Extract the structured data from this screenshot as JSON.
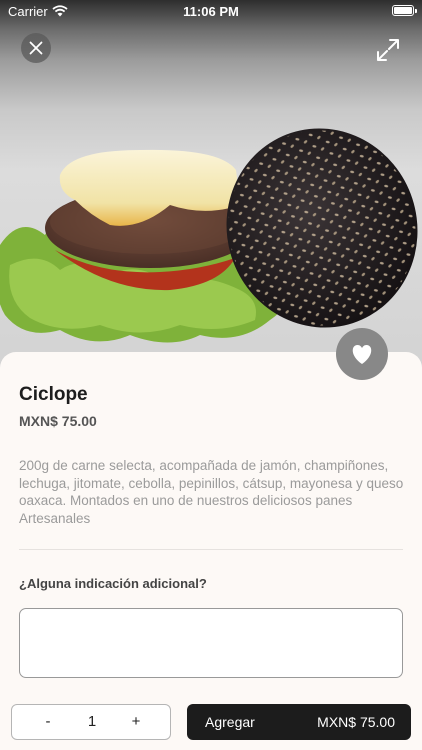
{
  "status_bar": {
    "carrier": "Carrier",
    "time": "11:06 PM"
  },
  "icons": {
    "close": "close-icon",
    "expand": "expand-icon",
    "favorite": "heart-icon",
    "wifi": "wifi-icon",
    "battery": "battery-icon"
  },
  "product": {
    "name": "Ciclope",
    "price": "MXN$ 75.00",
    "description": "200g de carne selecta, acompañada de jamón, champiñones, lechuga, jitomate, cebolla, pepinillos, cátsup, mayonesa y queso oaxaca. Montados en uno de nuestros deliciosos panes Artesanales"
  },
  "instructions": {
    "label": "¿Alguna indicación adicional?",
    "value": "",
    "placeholder": ""
  },
  "order": {
    "minus_label": "-",
    "quantity": "1",
    "plus_label": "+",
    "add_label": "Agregar",
    "total": "MXN$ 75.00"
  },
  "colors": {
    "sheet_bg": "#fdf9f6",
    "button_dark": "#1c1c1c",
    "fav_bg": "#888888"
  }
}
